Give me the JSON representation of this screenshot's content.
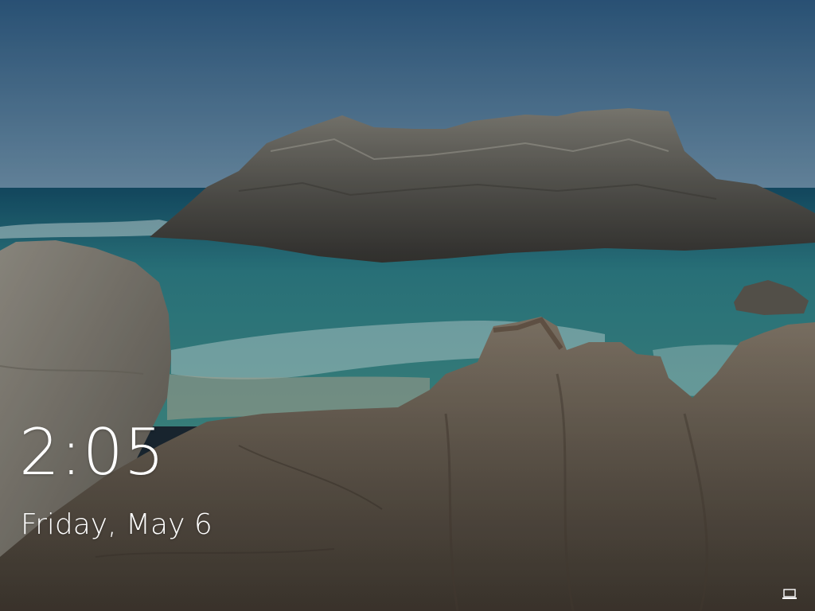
{
  "lockscreen": {
    "time": "2:05",
    "date": "Friday, May 6"
  },
  "status_icons": [
    "network-icon"
  ],
  "colors": {
    "text": "#ffffff",
    "sky_top": "#2f5c84",
    "sky_horizon": "#6f93ad",
    "sea": "#2e7f88",
    "rock": "#8a8578"
  }
}
